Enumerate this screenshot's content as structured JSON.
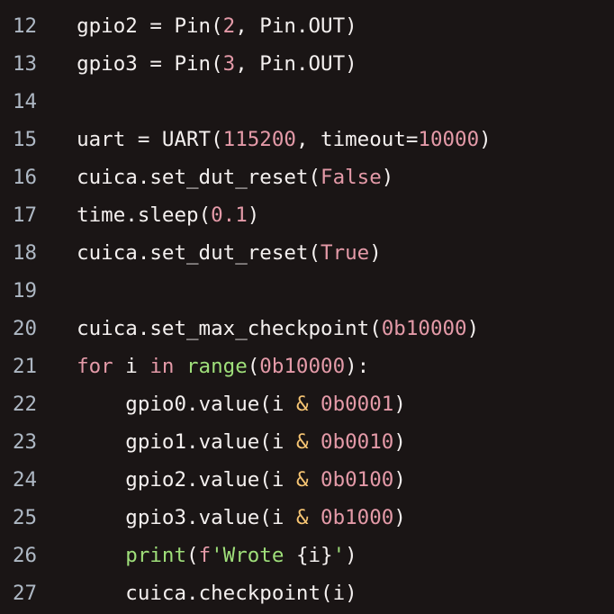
{
  "lines": [
    {
      "num": "12",
      "tokens": [
        {
          "t": "gpio2",
          "c": "tok-name"
        },
        {
          "t": " ",
          "c": "tok-name"
        },
        {
          "t": "=",
          "c": "tok-op"
        },
        {
          "t": " ",
          "c": "tok-name"
        },
        {
          "t": "Pin",
          "c": "tok-func"
        },
        {
          "t": "(",
          "c": "tok-punc"
        },
        {
          "t": "2",
          "c": "tok-num"
        },
        {
          "t": ",",
          "c": "tok-punc"
        },
        {
          "t": " ",
          "c": "tok-name"
        },
        {
          "t": "Pin",
          "c": "tok-name"
        },
        {
          "t": ".",
          "c": "dot"
        },
        {
          "t": "OUT",
          "c": "tok-name"
        },
        {
          "t": ")",
          "c": "tok-punc"
        }
      ]
    },
    {
      "num": "13",
      "tokens": [
        {
          "t": "gpio3",
          "c": "tok-name"
        },
        {
          "t": " ",
          "c": "tok-name"
        },
        {
          "t": "=",
          "c": "tok-op"
        },
        {
          "t": " ",
          "c": "tok-name"
        },
        {
          "t": "Pin",
          "c": "tok-func"
        },
        {
          "t": "(",
          "c": "tok-punc"
        },
        {
          "t": "3",
          "c": "tok-num"
        },
        {
          "t": ",",
          "c": "tok-punc"
        },
        {
          "t": " ",
          "c": "tok-name"
        },
        {
          "t": "Pin",
          "c": "tok-name"
        },
        {
          "t": ".",
          "c": "dot"
        },
        {
          "t": "OUT",
          "c": "tok-name"
        },
        {
          "t": ")",
          "c": "tok-punc"
        }
      ]
    },
    {
      "num": "14",
      "tokens": []
    },
    {
      "num": "15",
      "tokens": [
        {
          "t": "uart",
          "c": "tok-name"
        },
        {
          "t": " ",
          "c": "tok-name"
        },
        {
          "t": "=",
          "c": "tok-op"
        },
        {
          "t": " ",
          "c": "tok-name"
        },
        {
          "t": "UART",
          "c": "tok-func"
        },
        {
          "t": "(",
          "c": "tok-punc"
        },
        {
          "t": "115200",
          "c": "tok-num"
        },
        {
          "t": ",",
          "c": "tok-punc"
        },
        {
          "t": " ",
          "c": "tok-name"
        },
        {
          "t": "timeout",
          "c": "tok-name"
        },
        {
          "t": "=",
          "c": "tok-op"
        },
        {
          "t": "10000",
          "c": "tok-num"
        },
        {
          "t": ")",
          "c": "tok-punc"
        }
      ]
    },
    {
      "num": "16",
      "tokens": [
        {
          "t": "cuica",
          "c": "tok-name"
        },
        {
          "t": ".",
          "c": "dot"
        },
        {
          "t": "set_dut_reset",
          "c": "tok-call"
        },
        {
          "t": "(",
          "c": "tok-punc"
        },
        {
          "t": "False",
          "c": "tok-bool"
        },
        {
          "t": ")",
          "c": "tok-punc"
        }
      ]
    },
    {
      "num": "17",
      "tokens": [
        {
          "t": "time",
          "c": "tok-name"
        },
        {
          "t": ".",
          "c": "dot"
        },
        {
          "t": "sleep",
          "c": "tok-call"
        },
        {
          "t": "(",
          "c": "tok-punc"
        },
        {
          "t": "0.1",
          "c": "tok-num"
        },
        {
          "t": ")",
          "c": "tok-punc"
        }
      ]
    },
    {
      "num": "18",
      "tokens": [
        {
          "t": "cuica",
          "c": "tok-name"
        },
        {
          "t": ".",
          "c": "dot"
        },
        {
          "t": "set_dut_reset",
          "c": "tok-call"
        },
        {
          "t": "(",
          "c": "tok-punc"
        },
        {
          "t": "True",
          "c": "tok-bool"
        },
        {
          "t": ")",
          "c": "tok-punc"
        }
      ]
    },
    {
      "num": "19",
      "tokens": []
    },
    {
      "num": "20",
      "tokens": [
        {
          "t": "cuica",
          "c": "tok-name"
        },
        {
          "t": ".",
          "c": "dot"
        },
        {
          "t": "set_max_checkpoint",
          "c": "tok-call"
        },
        {
          "t": "(",
          "c": "tok-punc"
        },
        {
          "t": "0b10000",
          "c": "tok-num"
        },
        {
          "t": ")",
          "c": "tok-punc"
        }
      ]
    },
    {
      "num": "21",
      "tokens": [
        {
          "t": "for",
          "c": "tok-kw"
        },
        {
          "t": " ",
          "c": "tok-name"
        },
        {
          "t": "i",
          "c": "tok-name"
        },
        {
          "t": " ",
          "c": "tok-name"
        },
        {
          "t": "in",
          "c": "tok-kw"
        },
        {
          "t": " ",
          "c": "tok-name"
        },
        {
          "t": "range",
          "c": "tok-builtin"
        },
        {
          "t": "(",
          "c": "tok-punc"
        },
        {
          "t": "0b10000",
          "c": "tok-num"
        },
        {
          "t": "):",
          "c": "tok-punc"
        }
      ]
    },
    {
      "num": "22",
      "indent": 1,
      "tokens": [
        {
          "t": "gpio0",
          "c": "tok-name"
        },
        {
          "t": ".",
          "c": "dot"
        },
        {
          "t": "value",
          "c": "tok-call"
        },
        {
          "t": "(",
          "c": "tok-punc"
        },
        {
          "t": "i",
          "c": "tok-name"
        },
        {
          "t": " ",
          "c": "tok-name"
        },
        {
          "t": "&",
          "c": "tok-kwop"
        },
        {
          "t": " ",
          "c": "tok-name"
        },
        {
          "t": "0b0001",
          "c": "tok-num"
        },
        {
          "t": ")",
          "c": "tok-punc"
        }
      ]
    },
    {
      "num": "23",
      "indent": 1,
      "tokens": [
        {
          "t": "gpio1",
          "c": "tok-name"
        },
        {
          "t": ".",
          "c": "dot"
        },
        {
          "t": "value",
          "c": "tok-call"
        },
        {
          "t": "(",
          "c": "tok-punc"
        },
        {
          "t": "i",
          "c": "tok-name"
        },
        {
          "t": " ",
          "c": "tok-name"
        },
        {
          "t": "&",
          "c": "tok-kwop"
        },
        {
          "t": " ",
          "c": "tok-name"
        },
        {
          "t": "0b0010",
          "c": "tok-num"
        },
        {
          "t": ")",
          "c": "tok-punc"
        }
      ]
    },
    {
      "num": "24",
      "indent": 1,
      "tokens": [
        {
          "t": "gpio2",
          "c": "tok-name"
        },
        {
          "t": ".",
          "c": "dot"
        },
        {
          "t": "value",
          "c": "tok-call"
        },
        {
          "t": "(",
          "c": "tok-punc"
        },
        {
          "t": "i",
          "c": "tok-name"
        },
        {
          "t": " ",
          "c": "tok-name"
        },
        {
          "t": "&",
          "c": "tok-kwop"
        },
        {
          "t": " ",
          "c": "tok-name"
        },
        {
          "t": "0b0100",
          "c": "tok-num"
        },
        {
          "t": ")",
          "c": "tok-punc"
        }
      ]
    },
    {
      "num": "25",
      "indent": 1,
      "tokens": [
        {
          "t": "gpio3",
          "c": "tok-name"
        },
        {
          "t": ".",
          "c": "dot"
        },
        {
          "t": "value",
          "c": "tok-call"
        },
        {
          "t": "(",
          "c": "tok-punc"
        },
        {
          "t": "i",
          "c": "tok-name"
        },
        {
          "t": " ",
          "c": "tok-name"
        },
        {
          "t": "&",
          "c": "tok-kwop"
        },
        {
          "t": " ",
          "c": "tok-name"
        },
        {
          "t": "0b1000",
          "c": "tok-num"
        },
        {
          "t": ")",
          "c": "tok-punc"
        }
      ]
    },
    {
      "num": "26",
      "indent": 1,
      "tokens": [
        {
          "t": "print",
          "c": "tok-builtin"
        },
        {
          "t": "(",
          "c": "tok-punc"
        },
        {
          "t": "f",
          "c": "tok-fstr"
        },
        {
          "t": "'Wrote ",
          "c": "tok-str"
        },
        {
          "t": "{",
          "c": "tok-punc"
        },
        {
          "t": "i",
          "c": "tok-name"
        },
        {
          "t": "}",
          "c": "tok-punc"
        },
        {
          "t": "'",
          "c": "tok-str"
        },
        {
          "t": ")",
          "c": "tok-punc"
        }
      ]
    },
    {
      "num": "27",
      "indent": 1,
      "tokens": [
        {
          "t": "cuica",
          "c": "tok-name"
        },
        {
          "t": ".",
          "c": "dot"
        },
        {
          "t": "checkpoint",
          "c": "tok-call"
        },
        {
          "t": "(",
          "c": "tok-punc"
        },
        {
          "t": "i",
          "c": "tok-name"
        },
        {
          "t": ")",
          "c": "tok-punc"
        }
      ]
    }
  ],
  "indent_unit": "    "
}
